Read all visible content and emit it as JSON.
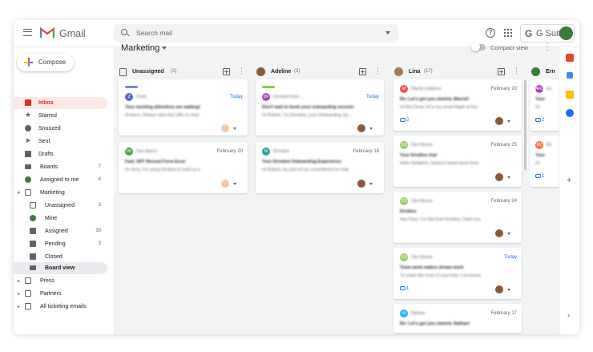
{
  "app": {
    "name": "Gmail",
    "suite": "G Suite"
  },
  "search": {
    "placeholder": "Search mail"
  },
  "compose": {
    "label": "Compose"
  },
  "sidebar": {
    "items": [
      {
        "label": "Inbox",
        "count": ""
      },
      {
        "label": "Starred",
        "count": ""
      },
      {
        "label": "Snoozed",
        "count": ""
      },
      {
        "label": "Sent",
        "count": ""
      },
      {
        "label": "Drafts",
        "count": ""
      },
      {
        "label": "Boards",
        "count": "7"
      },
      {
        "label": "Assigned to me",
        "count": "4"
      },
      {
        "label": "Marketing",
        "count": ""
      },
      {
        "label": "Unassigned",
        "count": "3"
      },
      {
        "label": "Mine",
        "count": ""
      },
      {
        "label": "Assigned",
        "count": "30"
      },
      {
        "label": "Pending",
        "count": "3"
      },
      {
        "label": "Closed",
        "count": ""
      },
      {
        "label": "Board view",
        "count": ""
      },
      {
        "label": "Press",
        "count": ""
      },
      {
        "label": "Partners",
        "count": ""
      },
      {
        "label": "All ticketing emails",
        "count": ""
      }
    ]
  },
  "board": {
    "title": "Marketing",
    "compact_label": "Compact view",
    "columns": [
      {
        "name": "Unassigned",
        "count": "(2)"
      },
      {
        "name": "Adeline",
        "count": "(2)"
      },
      {
        "name": "Lina",
        "count": "(17)"
      },
      {
        "name": "Ern",
        "count": ""
      }
    ]
  },
  "cards": {
    "unassigned": [
      {
        "initial": "Z",
        "who": "Zoeb",
        "date": "Today",
        "l1": "Your meeting attendees are waiting!",
        "l2": "Hi there, Please click this URL to start"
      },
      {
        "initial": "DB",
        "who": "Dan Barns",
        "date": "February 20",
        "l1": "Fwd: SFF Record Form Error",
        "l2": "Hi Jerry, I'm using Drrallus to sold us a"
      }
    ],
    "adeline": [
      {
        "initial": "DF",
        "who": "Drrmbot from ...",
        "date": "Today",
        "l1": "Don't wait to book your onboarding session",
        "l2": "Hi Robert, I'm Drrmbot, your Onboarding Sp..."
      },
      {
        "initial": "M",
        "who": "Drrmbot",
        "date": "February 18",
        "l1": "Your Drrmbot Onboarding Experience",
        "l2": "Hi Robert, As part of our commitment to mak"
      }
    ],
    "lina": [
      {
        "initial": "M",
        "who": "Marek Zablerra",
        "date": "February 20",
        "comments": "2",
        "l1": "Re: Let's get you started, Marcel!",
        "l2": "Hi Ben Deal, Hi is my email Right at this"
      },
      {
        "initial": "SO",
        "who": "Ola Olsson",
        "date": "February 25",
        "comments": "",
        "l1": "Your Drrallus trial",
        "l2": "Hello Nellighm, Haven't heard back from"
      },
      {
        "initial": "SO",
        "who": "Ola Olsson",
        "date": "February 24",
        "comments": "",
        "l1": "Drrallus",
        "l2": "Hey Paul, I'm Ola from Drrallus, Glad you"
      },
      {
        "initial": "SO",
        "who": "Ola Olsson",
        "date": "Today",
        "comments": "1",
        "l1": "Team work makes dream work",
        "l2": "To make the most of your trial, I recomme"
      },
      {
        "initial": "N",
        "who": "Nathan",
        "date": "February 17",
        "comments": "",
        "l1": "Re: Let's get you started, Nathan!",
        "l2": "Hi, let's go"
      }
    ],
    "ern": [
      {
        "initial": "AFC",
        "who": "Ko",
        "date": "",
        "comments": "2",
        "l1": "Your",
        "l2": "Hi"
      },
      {
        "initial": "MJ",
        "who": "Mi",
        "date": "",
        "comments": "1",
        "l1": "Your",
        "l2": "Hi"
      }
    ]
  }
}
